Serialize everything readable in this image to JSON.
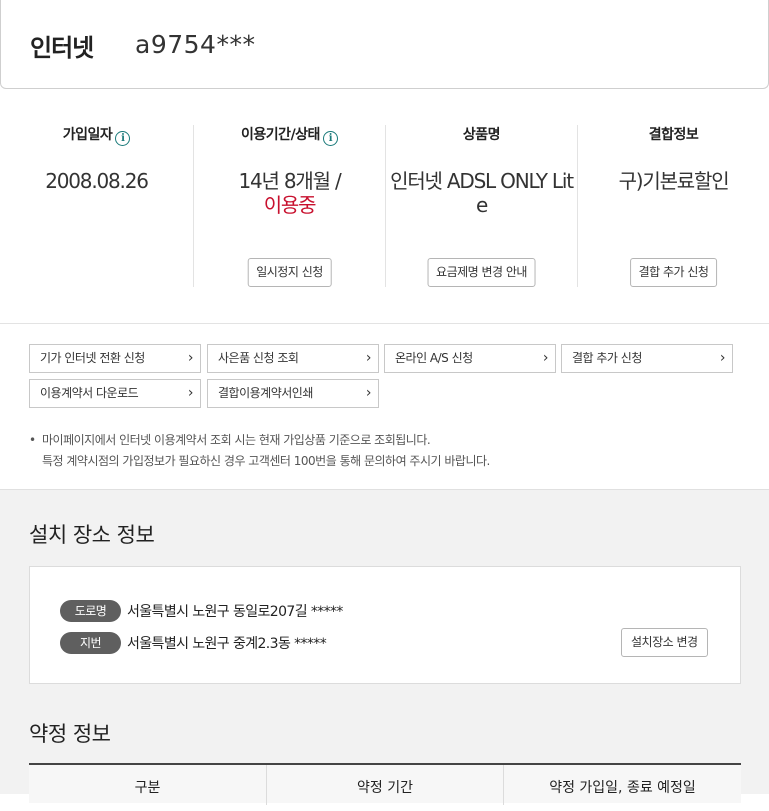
{
  "header": {
    "service": "인터넷",
    "account": "a9754***"
  },
  "info": {
    "join_date_label": "가입일자",
    "join_date": "2008.08.26",
    "period_label": "이용기간/상태",
    "period": "14년 8개월 /",
    "status": "이용중",
    "suspend_button": "일시정지 신청",
    "product_label": "상품명",
    "product": "인터넷 ADSL ONLY Lite",
    "plan_change_button": "요금제명 변경 안내",
    "bundle_label": "결합정보",
    "bundle": "구)기본료할인",
    "bundle_add_button": "결합 추가 신청",
    "info_icon": "info-circle-icon"
  },
  "links": [
    "기가 인터넷 전환 신청",
    "사은품 신청 조회",
    "온라인 A/S 신청",
    "결합 추가 신청",
    "이용계약서 다운로드",
    "결합이용계약서인쇄"
  ],
  "notice": {
    "bullet": "•",
    "line1": "마이페이지에서 인터넷 이용계약서 조회 시는 현재 가입상품 기준으로 조회됩니다.",
    "line2": "특정 계약시점의 가입정보가 필요하신 경우 고객센터 100번을 통해 문의하여 주시기 바랍니다."
  },
  "install": {
    "title": "설치 장소 정보",
    "road_tag": "도로명",
    "road_address": "서울특별시 노원구 동일로207길 *****",
    "lot_tag": "지번",
    "lot_address": "서울특별시 노원구 중계2.3동 *****",
    "change_button": "설치장소 변경"
  },
  "contract": {
    "title": "약정 정보",
    "columns": [
      "구분",
      "약정 기간",
      "약정 가입일, 종료 예정일"
    ]
  },
  "colors": {
    "accent_red": "#c8102e",
    "tag_bg": "#5f5f5f",
    "section_bg": "#f2f2f2"
  }
}
